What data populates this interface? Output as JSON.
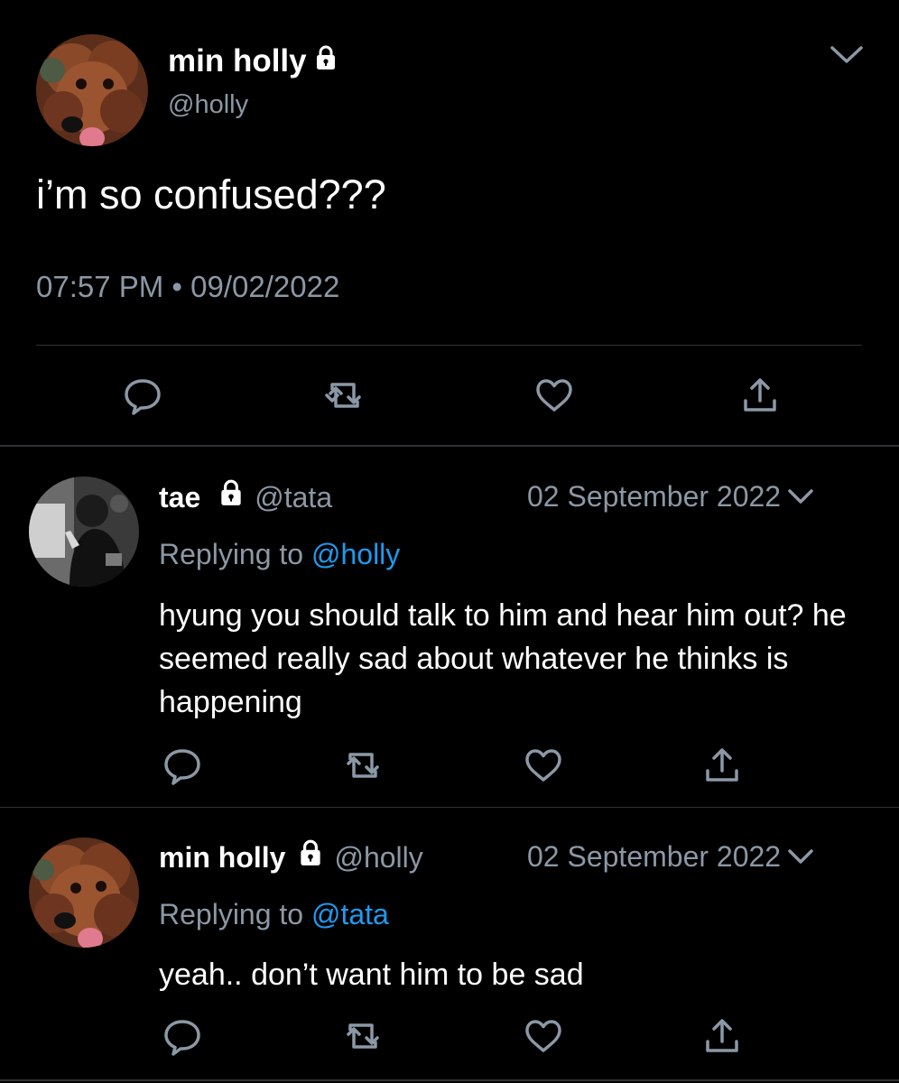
{
  "main_tweet": {
    "display_name": "min holly",
    "handle": "@holly",
    "text": "i’m so confused???",
    "timestamp": "07:57 PM • 09/02/2022",
    "protected": true
  },
  "replies": [
    {
      "display_name": "tae",
      "handle": "@tata",
      "date": "02 September 2022",
      "replying_prefix": "Replying to",
      "replying_to": "@holly",
      "text": "hyung you should talk to him and hear him out? he seemed really sad about whatever he thinks is happening",
      "protected": true
    },
    {
      "display_name": "min holly",
      "handle": "@holly",
      "date": "02 September 2022",
      "replying_prefix": "Replying to",
      "replying_to": "@tata",
      "text": "yeah.. don’t want him to be sad",
      "protected": true
    }
  ],
  "icons": {
    "reply": "reply-icon",
    "retweet": "retweet-icon",
    "like": "like-icon",
    "share": "share-icon",
    "lock": "lock-icon",
    "chevron": "chevron-down-icon"
  },
  "colors": {
    "background": "#000000",
    "text": "#ffffff",
    "secondary_text": "#8b98a5",
    "icon": "#8b98a5",
    "link": "#1d9bf0",
    "divider": "#2f3336"
  }
}
